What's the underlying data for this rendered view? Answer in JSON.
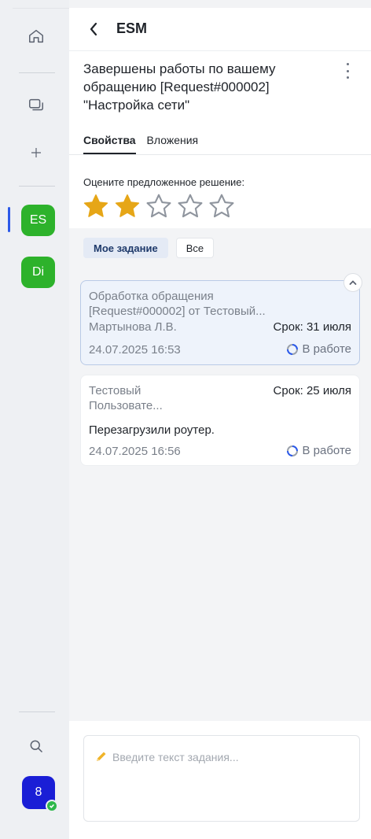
{
  "header": {
    "title": "ESM"
  },
  "ticket": {
    "title": "Завершены работы по вашему обращению [Request#000002] \"Настройка сети\""
  },
  "tabs": [
    {
      "label": "Свойства",
      "active": true
    },
    {
      "label": "Вложения",
      "active": false
    }
  ],
  "rating": {
    "label": "Оцените предложенное решение:",
    "value": 2,
    "max": 5,
    "star_color": "#e6a617"
  },
  "filters": [
    {
      "label": "Мое задание",
      "active": true
    },
    {
      "label": "Все",
      "active": false
    }
  ],
  "tasks": [
    {
      "line1": "Обработка обращения",
      "line2": "[Request#000002] от Тестовый...",
      "assignee": "Мартынова Л.В.",
      "due": "Срок: 31 июля",
      "datetime": "24.07.2025 16:53",
      "status": "В работе"
    },
    {
      "line1": "Тестовый",
      "line2": "Пользовате...",
      "due": "Срок: 25 июля",
      "message": "Перезагрузили роутер.",
      "datetime": "24.07.2025 16:56",
      "status": "В работе"
    }
  ],
  "rail": {
    "workspaces": [
      "ES",
      "Di"
    ],
    "user_badge": "8"
  },
  "composer": {
    "placeholder": "Введите текст задания..."
  },
  "colors": {
    "accent": "#2b59e8",
    "workspace": "#2db22b",
    "user": "#1a1ed6"
  }
}
